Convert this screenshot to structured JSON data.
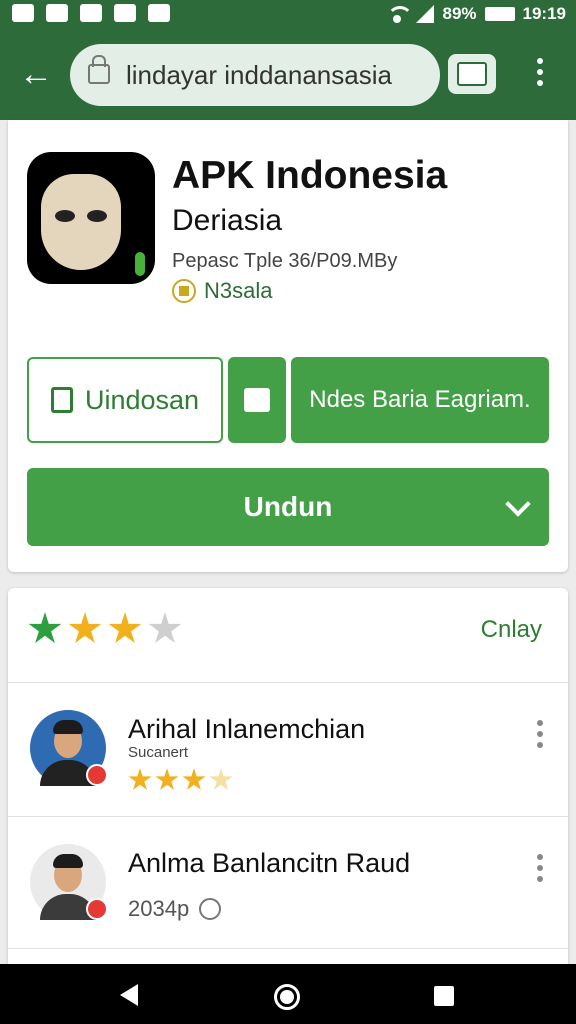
{
  "status_bar": {
    "battery": "89%",
    "time": "19:19"
  },
  "browser": {
    "url": "lindayar inddanansasia"
  },
  "app": {
    "title": "APK Indonesia",
    "subtitle": "Deriasia",
    "meta": "Pepasc Tple 36/P09.MBy",
    "badge": "N3sala"
  },
  "actions": {
    "outline_button": "Uindosan",
    "wide_button": "Ndes Baria Eagriam.",
    "main_button": "Undun"
  },
  "rating": {
    "stars_filled": 3,
    "stars_total": 4,
    "link": "Cnlay"
  },
  "reviews": [
    {
      "name": "Arihal Inlanemchian",
      "sub": "Sucanert",
      "stars": 3
    },
    {
      "name": "Anlma Banlancitn Raud",
      "date": "2034p"
    }
  ],
  "colors": {
    "brand_dark": "#2e6b3a",
    "brand_green": "#43a047",
    "star_gold": "#f2b01e"
  },
  "icons": [
    "back-arrow-icon",
    "lock-icon",
    "tab-switcher-icon",
    "more-vert-icon",
    "download-icon",
    "feedback-icon",
    "chevron-down-icon",
    "star-icon",
    "clock-icon"
  ]
}
